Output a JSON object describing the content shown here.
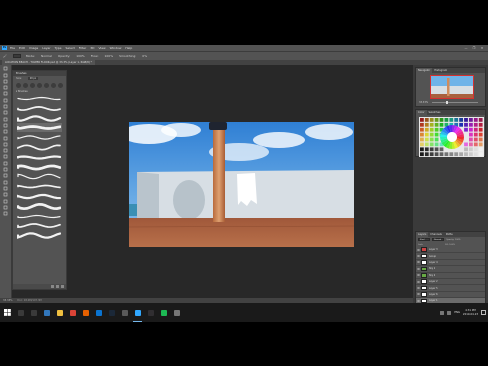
{
  "app": {
    "logo_text": "Ps",
    "menu": [
      "File",
      "Edit",
      "Image",
      "Layer",
      "Type",
      "Select",
      "Filter",
      "3D",
      "View",
      "Window",
      "Help"
    ],
    "window_controls": [
      "—",
      "❐",
      "✕"
    ]
  },
  "options_bar": {
    "items": [
      "Mode:",
      "Normal",
      "Opacity:",
      "Flow:",
      "Smoothing:"
    ],
    "opacity_value": "100%",
    "flow_value": "100%",
    "smoothing_value": "0%"
  },
  "document": {
    "tab_title": "LOCATION BEACH - TOWER FLOOR.psd @ 33.3% (Layer 1, RGB/8) *"
  },
  "tools": [
    "move",
    "marquee",
    "lasso",
    "quick-select",
    "crop",
    "eyedropper",
    "healing",
    "brush",
    "stamp",
    "history",
    "eraser",
    "gradient",
    "blur",
    "dodge",
    "pen",
    "type",
    "path-select",
    "shape",
    "hand",
    "zoom",
    "more",
    "colors",
    "mask",
    "screen-mode"
  ],
  "brushes_panel": {
    "title": "Brushes",
    "size_label": "Size:",
    "size_value": "48 px",
    "folder_label": "Brushes",
    "stroke_count": 15,
    "selected_index": 3
  },
  "navigator_panel": {
    "tabs": [
      "Navigator",
      "Histogram"
    ],
    "zoom": "33.33%"
  },
  "color_panel": {
    "tabs": [
      "Color",
      "Swatches"
    ]
  },
  "layers_panel": {
    "tabs": [
      "Layers",
      "Channels",
      "Paths"
    ],
    "kind_label": "Kind",
    "blend_mode": "Normal",
    "opacity_label": "Opacity: 100%",
    "lock_label": "Lock:",
    "fill_label": "Fill: 100%",
    "layers": [
      {
        "name": "Layer 3",
        "thumb": "red",
        "selected": false
      },
      {
        "name": "Group",
        "thumb": "white",
        "selected": false
      },
      {
        "name": "Layer 4",
        "thumb": "white",
        "selected": false
      },
      {
        "name": "Sky 1",
        "thumb": "green",
        "selected": false
      },
      {
        "name": "Sky 2",
        "thumb": "green",
        "selected": false
      },
      {
        "name": "Layer 2",
        "thumb": "white",
        "selected": false
      },
      {
        "name": "Layer 5",
        "thumb": "white",
        "selected": false
      },
      {
        "name": "Layer 6",
        "thumb": "white",
        "selected": false
      },
      {
        "name": "Layer 1",
        "thumb": "white",
        "selected": true
      },
      {
        "name": "Beach",
        "thumb": "white",
        "selected": false
      },
      {
        "name": "Tower",
        "thumb": "white",
        "selected": false
      },
      {
        "name": "Background",
        "thumb": "white",
        "selected": false
      }
    ]
  },
  "status_bar": {
    "zoom": "33.33%",
    "doc_info": "Doc: 18.0M/107.3M"
  },
  "taskbar": {
    "apps": [
      {
        "name": "cortana",
        "color": "#3a3a3a"
      },
      {
        "name": "task-view",
        "color": "#3a3a3a"
      },
      {
        "name": "edge",
        "color": "#3277bc"
      },
      {
        "name": "file-explorer",
        "color": "#f0c040"
      },
      {
        "name": "chrome",
        "color": "#db4437"
      },
      {
        "name": "firefox",
        "color": "#e66000"
      },
      {
        "name": "store",
        "color": "#0a74d1"
      },
      {
        "name": "steam",
        "color": "#1b2838"
      },
      {
        "name": "app",
        "color": "#5a5a5a"
      },
      {
        "name": "photoshop",
        "color": "#31a8ff"
      },
      {
        "name": "obs",
        "color": "#302e31"
      },
      {
        "name": "spotify",
        "color": "#1db954"
      },
      {
        "name": "app2",
        "color": "#777777"
      }
    ],
    "active_app": "photoshop",
    "language": "ENG",
    "time": "4:31 PM",
    "date": "2019-04-23"
  },
  "colors": {
    "accent": "#31a8ff",
    "selection_red": "#d43030"
  }
}
